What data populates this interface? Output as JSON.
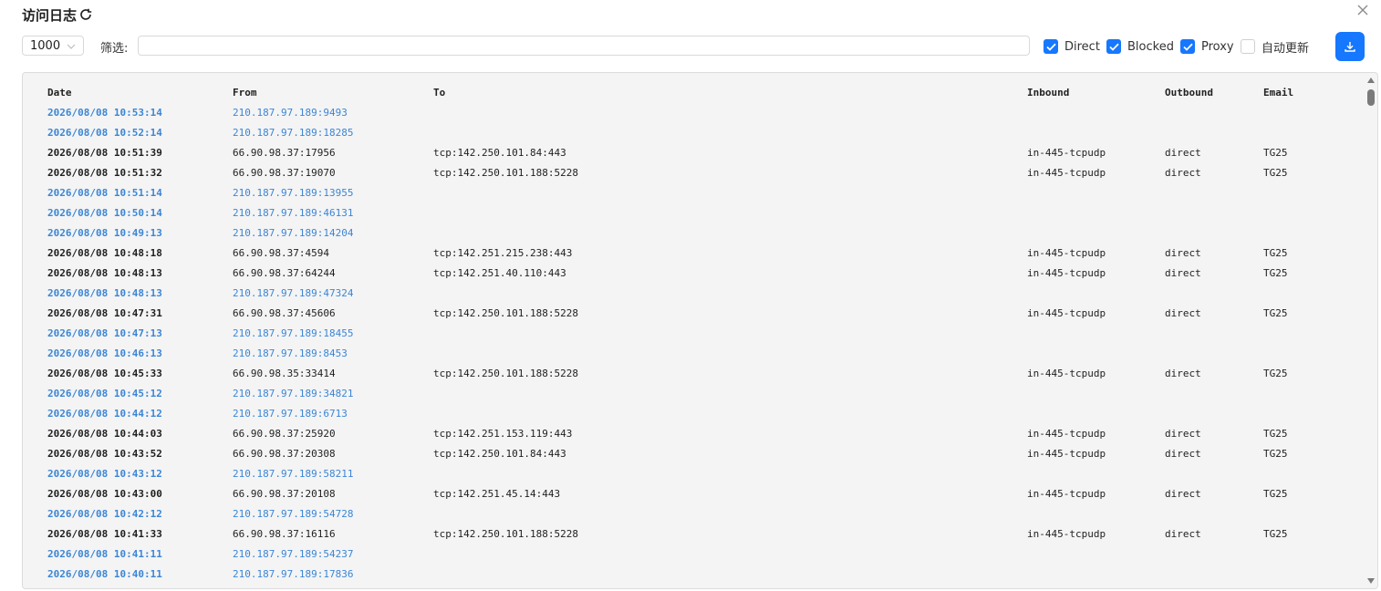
{
  "header": {
    "title": "访问日志",
    "refresh_icon": "refresh-icon",
    "close_icon": "close-icon"
  },
  "toolbar": {
    "limit_value": "1000",
    "filter_label": "筛选:",
    "filter_value": "",
    "checkboxes": [
      {
        "label": "Direct",
        "checked": true
      },
      {
        "label": "Blocked",
        "checked": true
      },
      {
        "label": "Proxy",
        "checked": true
      },
      {
        "label": "自动更新",
        "checked": false
      }
    ],
    "download_icon": "download-icon",
    "accent_color": "#1677ff"
  },
  "log": {
    "columns": [
      "Date",
      "From",
      "To",
      "Inbound",
      "Outbound",
      "Email"
    ],
    "rows": [
      {
        "date": "2026/08/08 10:53:14",
        "from": "210.187.97.189:9493",
        "to": "",
        "inbound": "",
        "outbound": "",
        "email": "",
        "style": "blue"
      },
      {
        "date": "2026/08/08 10:52:14",
        "from": "210.187.97.189:18285",
        "to": "",
        "inbound": "",
        "outbound": "",
        "email": "",
        "style": "blue"
      },
      {
        "date": "2026/08/08 10:51:39",
        "from": "66.90.98.37:17956",
        "to": "tcp:142.250.101.84:443",
        "inbound": "in-445-tcpudp",
        "outbound": "direct",
        "email": "TG25",
        "style": "dark"
      },
      {
        "date": "2026/08/08 10:51:32",
        "from": "66.90.98.37:19070",
        "to": "tcp:142.250.101.188:5228",
        "inbound": "in-445-tcpudp",
        "outbound": "direct",
        "email": "TG25",
        "style": "dark"
      },
      {
        "date": "2026/08/08 10:51:14",
        "from": "210.187.97.189:13955",
        "to": "",
        "inbound": "",
        "outbound": "",
        "email": "",
        "style": "blue"
      },
      {
        "date": "2026/08/08 10:50:14",
        "from": "210.187.97.189:46131",
        "to": "",
        "inbound": "",
        "outbound": "",
        "email": "",
        "style": "blue"
      },
      {
        "date": "2026/08/08 10:49:13",
        "from": "210.187.97.189:14204",
        "to": "",
        "inbound": "",
        "outbound": "",
        "email": "",
        "style": "blue"
      },
      {
        "date": "2026/08/08 10:48:18",
        "from": "66.90.98.37:4594",
        "to": "tcp:142.251.215.238:443",
        "inbound": "in-445-tcpudp",
        "outbound": "direct",
        "email": "TG25",
        "style": "dark"
      },
      {
        "date": "2026/08/08 10:48:13",
        "from": "66.90.98.37:64244",
        "to": "tcp:142.251.40.110:443",
        "inbound": "in-445-tcpudp",
        "outbound": "direct",
        "email": "TG25",
        "style": "dark"
      },
      {
        "date": "2026/08/08 10:48:13",
        "from": "210.187.97.189:47324",
        "to": "",
        "inbound": "",
        "outbound": "",
        "email": "",
        "style": "blue"
      },
      {
        "date": "2026/08/08 10:47:31",
        "from": "66.90.98.37:45606",
        "to": "tcp:142.250.101.188:5228",
        "inbound": "in-445-tcpudp",
        "outbound": "direct",
        "email": "TG25",
        "style": "dark"
      },
      {
        "date": "2026/08/08 10:47:13",
        "from": "210.187.97.189:18455",
        "to": "",
        "inbound": "",
        "outbound": "",
        "email": "",
        "style": "blue"
      },
      {
        "date": "2026/08/08 10:46:13",
        "from": "210.187.97.189:8453",
        "to": "",
        "inbound": "",
        "outbound": "",
        "email": "",
        "style": "blue"
      },
      {
        "date": "2026/08/08 10:45:33",
        "from": "66.90.98.35:33414",
        "to": "tcp:142.250.101.188:5228",
        "inbound": "in-445-tcpudp",
        "outbound": "direct",
        "email": "TG25",
        "style": "dark"
      },
      {
        "date": "2026/08/08 10:45:12",
        "from": "210.187.97.189:34821",
        "to": "",
        "inbound": "",
        "outbound": "",
        "email": "",
        "style": "blue"
      },
      {
        "date": "2026/08/08 10:44:12",
        "from": "210.187.97.189:6713",
        "to": "",
        "inbound": "",
        "outbound": "",
        "email": "",
        "style": "blue"
      },
      {
        "date": "2026/08/08 10:44:03",
        "from": "66.90.98.37:25920",
        "to": "tcp:142.251.153.119:443",
        "inbound": "in-445-tcpudp",
        "outbound": "direct",
        "email": "TG25",
        "style": "dark"
      },
      {
        "date": "2026/08/08 10:43:52",
        "from": "66.90.98.37:20308",
        "to": "tcp:142.250.101.84:443",
        "inbound": "in-445-tcpudp",
        "outbound": "direct",
        "email": "TG25",
        "style": "dark"
      },
      {
        "date": "2026/08/08 10:43:12",
        "from": "210.187.97.189:58211",
        "to": "",
        "inbound": "",
        "outbound": "",
        "email": "",
        "style": "blue"
      },
      {
        "date": "2026/08/08 10:43:00",
        "from": "66.90.98.37:20108",
        "to": "tcp:142.251.45.14:443",
        "inbound": "in-445-tcpudp",
        "outbound": "direct",
        "email": "TG25",
        "style": "dark"
      },
      {
        "date": "2026/08/08 10:42:12",
        "from": "210.187.97.189:54728",
        "to": "",
        "inbound": "",
        "outbound": "",
        "email": "",
        "style": "blue"
      },
      {
        "date": "2026/08/08 10:41:33",
        "from": "66.90.98.37:16116",
        "to": "tcp:142.250.101.188:5228",
        "inbound": "in-445-tcpudp",
        "outbound": "direct",
        "email": "TG25",
        "style": "dark"
      },
      {
        "date": "2026/08/08 10:41:11",
        "from": "210.187.97.189:54237",
        "to": "",
        "inbound": "",
        "outbound": "",
        "email": "",
        "style": "blue"
      },
      {
        "date": "2026/08/08 10:40:11",
        "from": "210.187.97.189:17836",
        "to": "",
        "inbound": "",
        "outbound": "",
        "email": "",
        "style": "blue"
      }
    ]
  }
}
